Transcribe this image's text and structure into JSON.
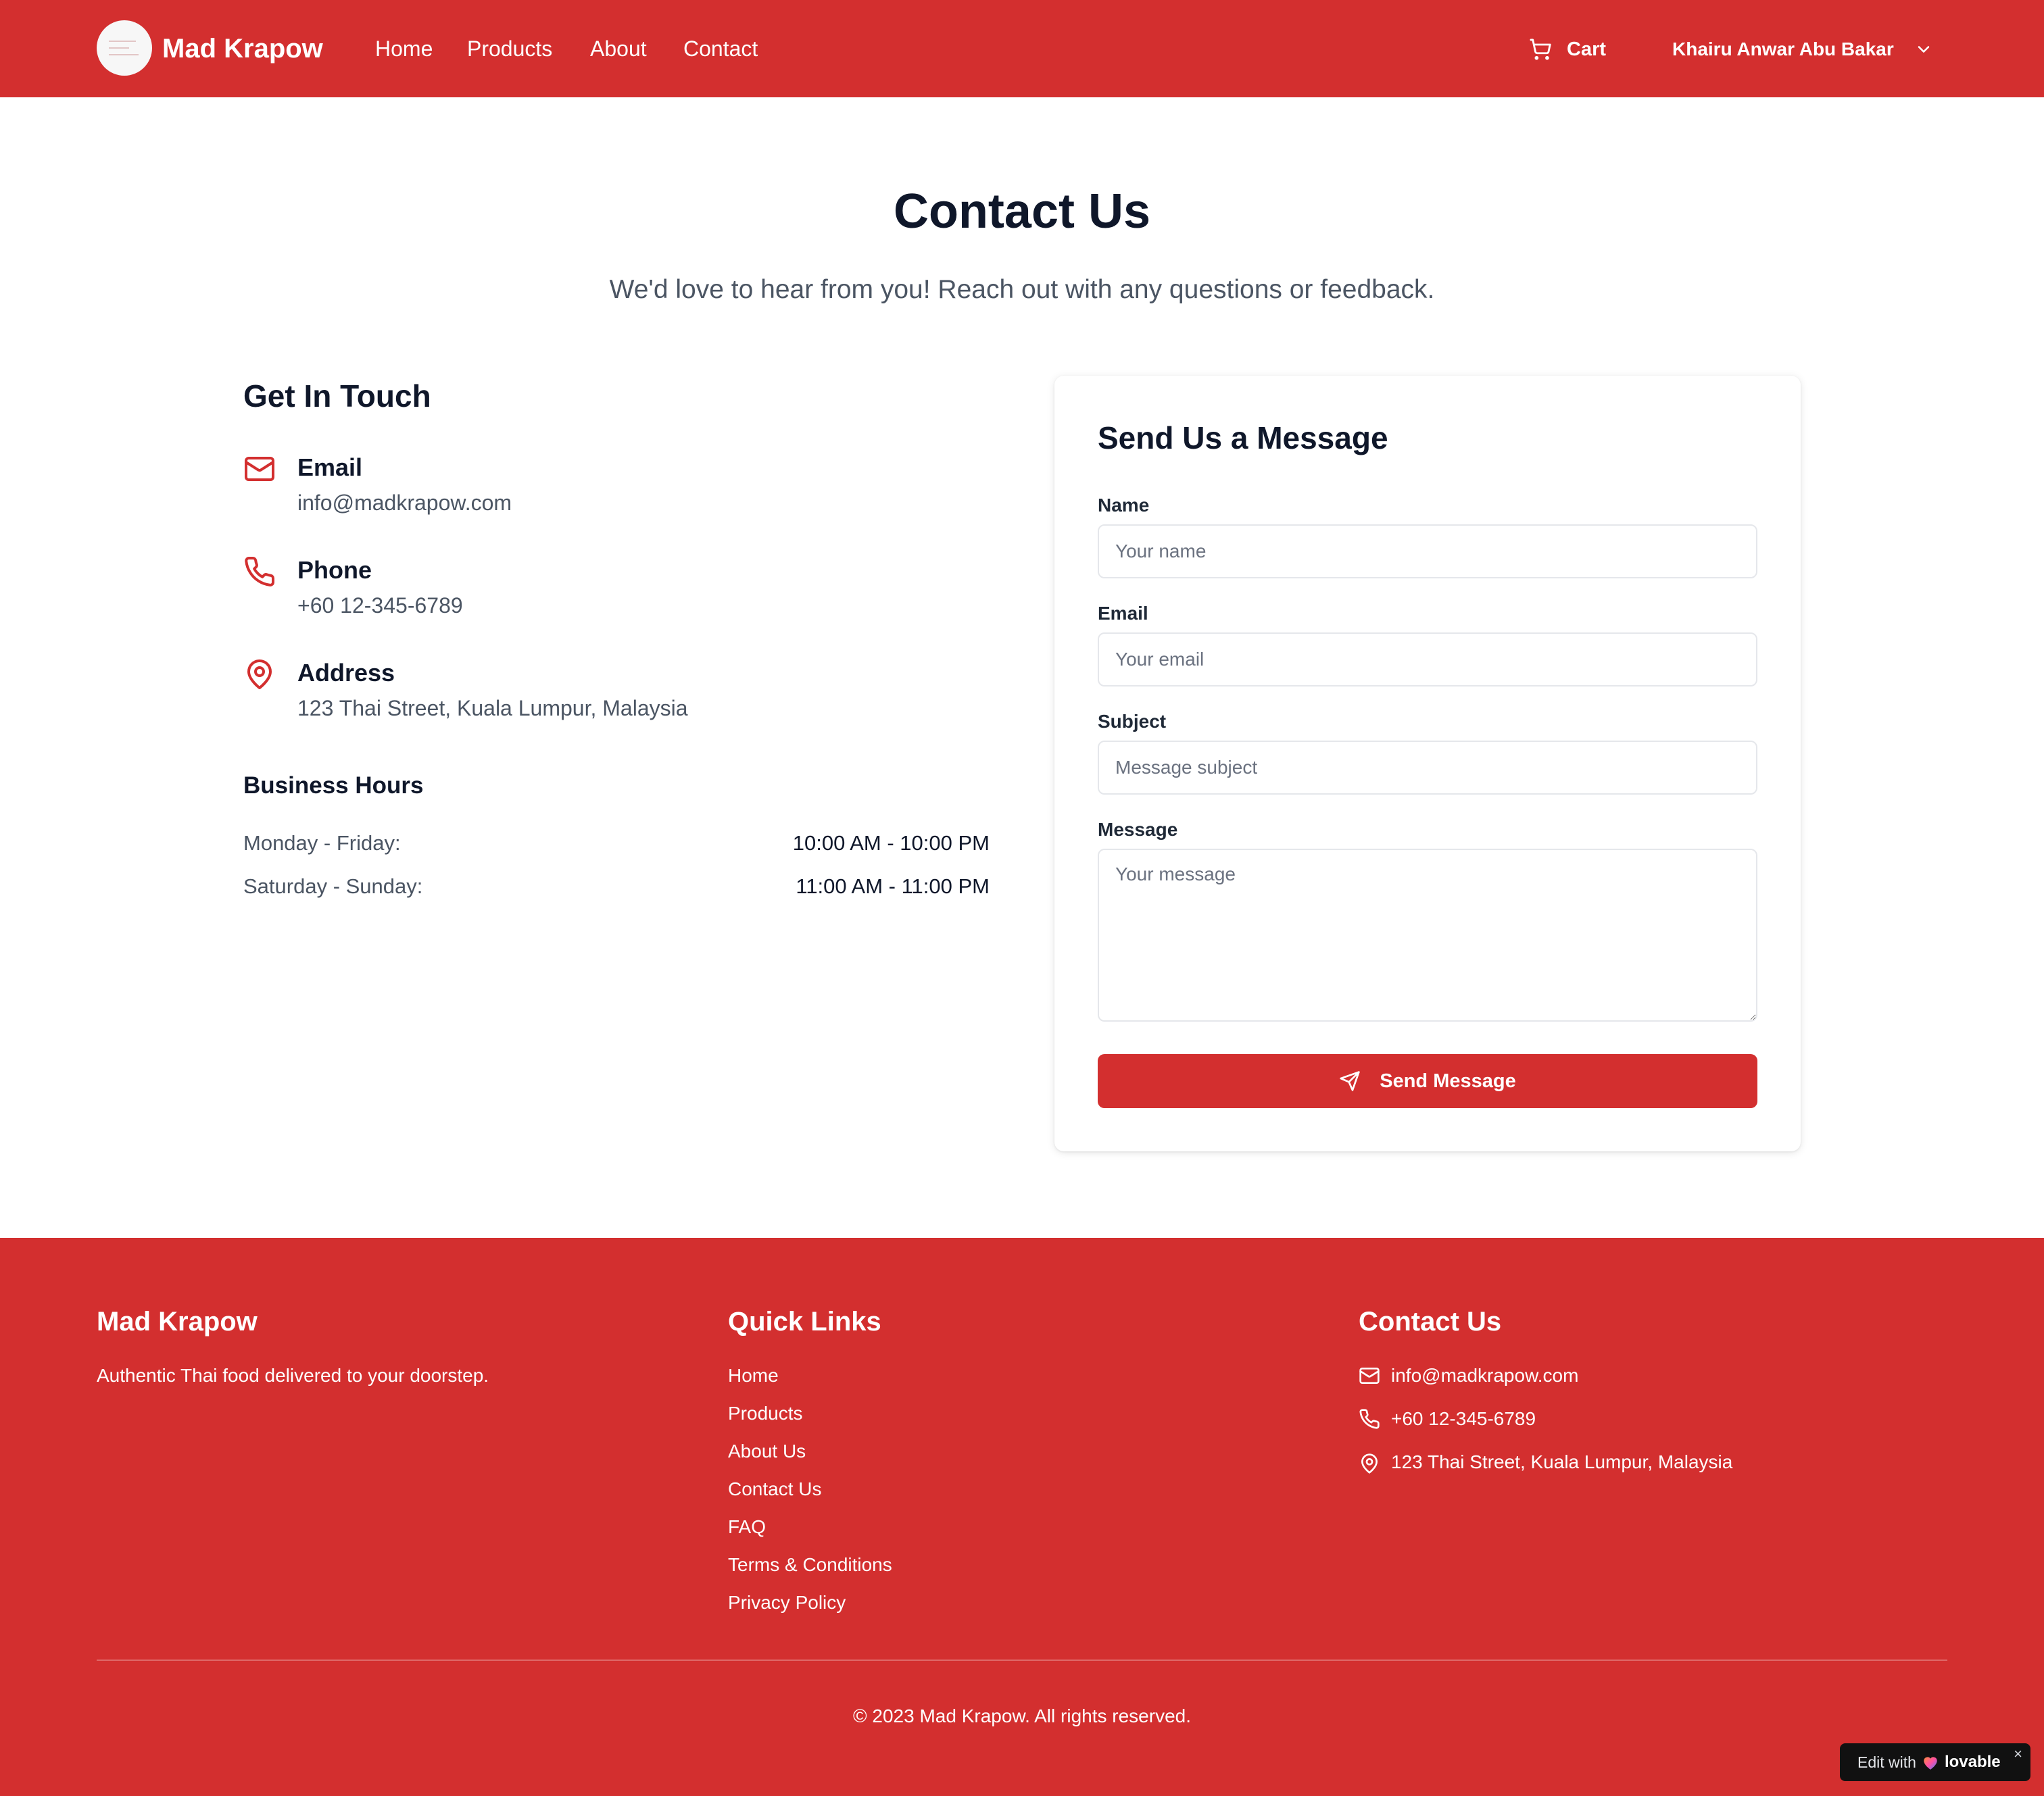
{
  "header": {
    "brand": "Mad Krapow",
    "nav": [
      {
        "label": "Home"
      },
      {
        "label": "Products"
      },
      {
        "label": "About"
      },
      {
        "label": "Contact"
      }
    ],
    "cart_label": "Cart",
    "user_name": "Khairu Anwar Abu Bakar"
  },
  "hero": {
    "title": "Contact Us",
    "subtitle": "We'd love to hear from you! Reach out with any questions or feedback."
  },
  "contact_info": {
    "heading": "Get In Touch",
    "items": [
      {
        "label": "Email",
        "value": "info@madkrapow.com",
        "icon": "mail-icon"
      },
      {
        "label": "Phone",
        "value": "+60 12-345-6789",
        "icon": "phone-icon"
      },
      {
        "label": "Address",
        "value": "123 Thai Street, Kuala Lumpur, Malaysia",
        "icon": "map-pin-icon"
      }
    ],
    "hours_heading": "Business Hours",
    "hours": [
      {
        "days": "Monday - Friday:",
        "time": "10:00 AM - 10:00 PM"
      },
      {
        "days": "Saturday - Sunday:",
        "time": "11:00 AM - 11:00 PM"
      }
    ]
  },
  "form": {
    "heading": "Send Us a Message",
    "name": {
      "label": "Name",
      "placeholder": "Your name",
      "value": ""
    },
    "email": {
      "label": "Email",
      "placeholder": "Your email",
      "value": ""
    },
    "subject": {
      "label": "Subject",
      "placeholder": "Message subject",
      "value": ""
    },
    "message": {
      "label": "Message",
      "placeholder": "Your message",
      "value": ""
    },
    "submit_label": "Send Message"
  },
  "footer": {
    "brand": "Mad Krapow",
    "tagline": "Authentic Thai food delivered to your doorstep.",
    "quick_links_heading": "Quick Links",
    "quick_links": [
      {
        "label": "Home"
      },
      {
        "label": "Products"
      },
      {
        "label": "About Us"
      },
      {
        "label": "Contact Us"
      },
      {
        "label": "FAQ"
      },
      {
        "label": "Terms & Conditions"
      },
      {
        "label": "Privacy Policy"
      }
    ],
    "contact_heading": "Contact Us",
    "contact": [
      {
        "value": "info@madkrapow.com",
        "icon": "mail-icon"
      },
      {
        "value": "+60 12-345-6789",
        "icon": "phone-icon"
      },
      {
        "value": "123 Thai Street, Kuala Lumpur, Malaysia",
        "icon": "map-pin-icon"
      }
    ],
    "copyright": "© 2023 Mad Krapow. All rights reserved."
  },
  "badge": {
    "prefix": "Edit with",
    "brand": "lovable",
    "close": "×"
  },
  "colors": {
    "brand_red": "#d32f2f",
    "heading_text": "#0f172a",
    "muted_text": "#4b5563"
  }
}
